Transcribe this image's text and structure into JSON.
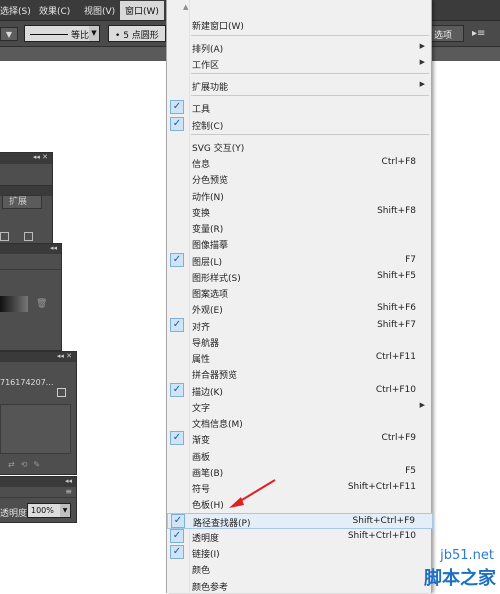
{
  "menubar": {
    "items": [
      {
        "label": "选择(S)"
      },
      {
        "label": "效果(C)"
      },
      {
        "label": "视图(V)"
      },
      {
        "label": "窗口(W)"
      }
    ]
  },
  "controlbar": {
    "stroke_label": "等比",
    "brush_label": "5 点圆形",
    "right_button": "选项"
  },
  "panels": {
    "expand_label": "扩展",
    "layer_row": "716174207...",
    "opacity_label": "透明度:",
    "opacity_value": "100%"
  },
  "menu": {
    "items": [
      {
        "label": "新建窗口(W)",
        "shortcut": "",
        "checked": false,
        "submenu": false
      },
      {
        "label": "排列(A)",
        "shortcut": "",
        "checked": false,
        "submenu": true
      },
      {
        "label": "工作区",
        "shortcut": "",
        "checked": false,
        "submenu": true
      },
      {
        "label": "扩展功能",
        "shortcut": "",
        "checked": false,
        "submenu": true
      },
      {
        "label": "工具",
        "shortcut": "",
        "checked": true,
        "submenu": false
      },
      {
        "label": "控制(C)",
        "shortcut": "",
        "checked": true,
        "submenu": false
      },
      {
        "label": "SVG 交互(Y)",
        "shortcut": "",
        "checked": false,
        "submenu": false
      },
      {
        "label": "信息",
        "shortcut": "Ctrl+F8",
        "checked": false,
        "submenu": false
      },
      {
        "label": "分色预览",
        "shortcut": "",
        "checked": false,
        "submenu": false
      },
      {
        "label": "动作(N)",
        "shortcut": "",
        "checked": false,
        "submenu": false
      },
      {
        "label": "变换",
        "shortcut": "Shift+F8",
        "checked": false,
        "submenu": false
      },
      {
        "label": "变量(R)",
        "shortcut": "",
        "checked": false,
        "submenu": false
      },
      {
        "label": "图像描摹",
        "shortcut": "",
        "checked": false,
        "submenu": false
      },
      {
        "label": "图层(L)",
        "shortcut": "F7",
        "checked": true,
        "submenu": false
      },
      {
        "label": "图形样式(S)",
        "shortcut": "Shift+F5",
        "checked": false,
        "submenu": false
      },
      {
        "label": "图案选项",
        "shortcut": "",
        "checked": false,
        "submenu": false
      },
      {
        "label": "外观(E)",
        "shortcut": "Shift+F6",
        "checked": false,
        "submenu": false
      },
      {
        "label": "对齐",
        "shortcut": "Shift+F7",
        "checked": true,
        "submenu": false
      },
      {
        "label": "导航器",
        "shortcut": "",
        "checked": false,
        "submenu": false
      },
      {
        "label": "属性",
        "shortcut": "Ctrl+F11",
        "checked": false,
        "submenu": false
      },
      {
        "label": "拼合器预览",
        "shortcut": "",
        "checked": false,
        "submenu": false
      },
      {
        "label": "描边(K)",
        "shortcut": "Ctrl+F10",
        "checked": true,
        "submenu": false
      },
      {
        "label": "文字",
        "shortcut": "",
        "checked": false,
        "submenu": true
      },
      {
        "label": "文档信息(M)",
        "shortcut": "",
        "checked": false,
        "submenu": false
      },
      {
        "label": "渐变",
        "shortcut": "Ctrl+F9",
        "checked": true,
        "submenu": false
      },
      {
        "label": "画板",
        "shortcut": "",
        "checked": false,
        "submenu": false
      },
      {
        "label": "画笔(B)",
        "shortcut": "F5",
        "checked": false,
        "submenu": false
      },
      {
        "label": "符号",
        "shortcut": "Shift+Ctrl+F11",
        "checked": false,
        "submenu": false
      },
      {
        "label": "色板(H)",
        "shortcut": "",
        "checked": false,
        "submenu": false
      },
      {
        "label": "路径查找器(P)",
        "shortcut": "Shift+Ctrl+F9",
        "checked": true,
        "submenu": false
      },
      {
        "label": "透明度",
        "shortcut": "Shift+Ctrl+F10",
        "checked": true,
        "submenu": false
      },
      {
        "label": "链接(I)",
        "shortcut": "",
        "checked": true,
        "submenu": false
      },
      {
        "label": "颜色",
        "shortcut": "",
        "checked": false,
        "submenu": false
      },
      {
        "label": "颜色参考",
        "shortcut": "",
        "checked": false,
        "submenu": false
      }
    ]
  },
  "watermark": {
    "site": "jb51.net",
    "name": "脚本之家"
  },
  "colors": {
    "menubar_bg": "#3b3b3b",
    "menu_bg": "#f0f0f0",
    "highlight": "#e3eef9",
    "check_blue": "#1b5aa0",
    "arrow_red": "#e02020",
    "watermark_blue": "#1f6fc4"
  }
}
